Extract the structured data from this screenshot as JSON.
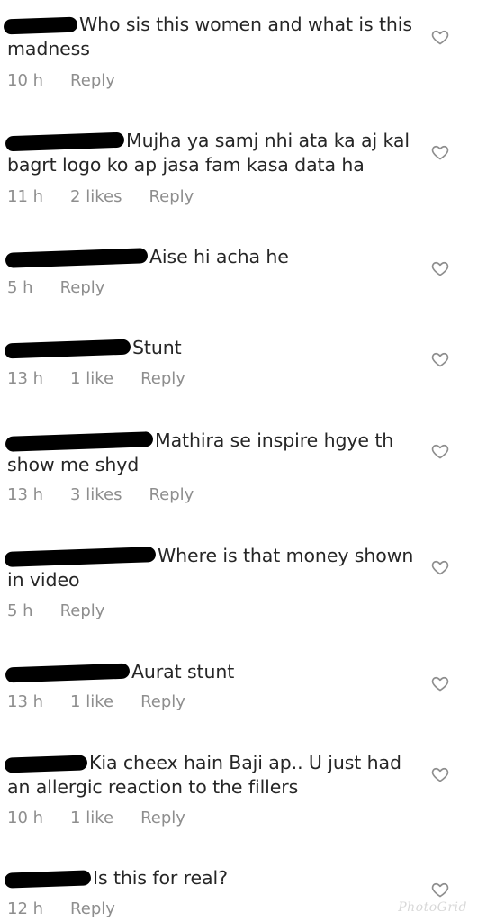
{
  "comments": [
    {
      "text": "Who sis this women and what is this madness",
      "time": "10 h",
      "likes": "",
      "reply": "Reply"
    },
    {
      "text": "Mujha ya samj nhi ata ka aj kal bagrt logo ko ap jasa fam kasa data ha",
      "time": "11 h",
      "likes": "2 likes",
      "reply": "Reply"
    },
    {
      "text": "Aise hi acha he",
      "time": "5 h",
      "likes": "",
      "reply": "Reply"
    },
    {
      "text": "Stunt",
      "time": "13 h",
      "likes": "1 like",
      "reply": "Reply"
    },
    {
      "text": "Mathira se inspire hgye th show me shyd",
      "time": "13 h",
      "likes": "3 likes",
      "reply": "Reply"
    },
    {
      "text": "Where is that money shown in video",
      "time": "5 h",
      "likes": "",
      "reply": "Reply"
    },
    {
      "text": "Aurat stunt",
      "time": "13 h",
      "likes": "1 like",
      "reply": "Reply"
    },
    {
      "text": "Kia cheex hain Baji ap.. U just had an allergic reaction to the fillers",
      "time": "10 h",
      "likes": "1 like",
      "reply": "Reply"
    },
    {
      "text": "Is this for real?",
      "time": "12 h",
      "likes": "",
      "reply": "Reply"
    }
  ],
  "icons": {
    "like": "heart-outline-icon"
  },
  "colors": {
    "text": "#262626",
    "meta": "#8e8e8e",
    "icon": "#8e8e8e",
    "redaction": "#000000"
  },
  "watermark": "PhotoGrid"
}
